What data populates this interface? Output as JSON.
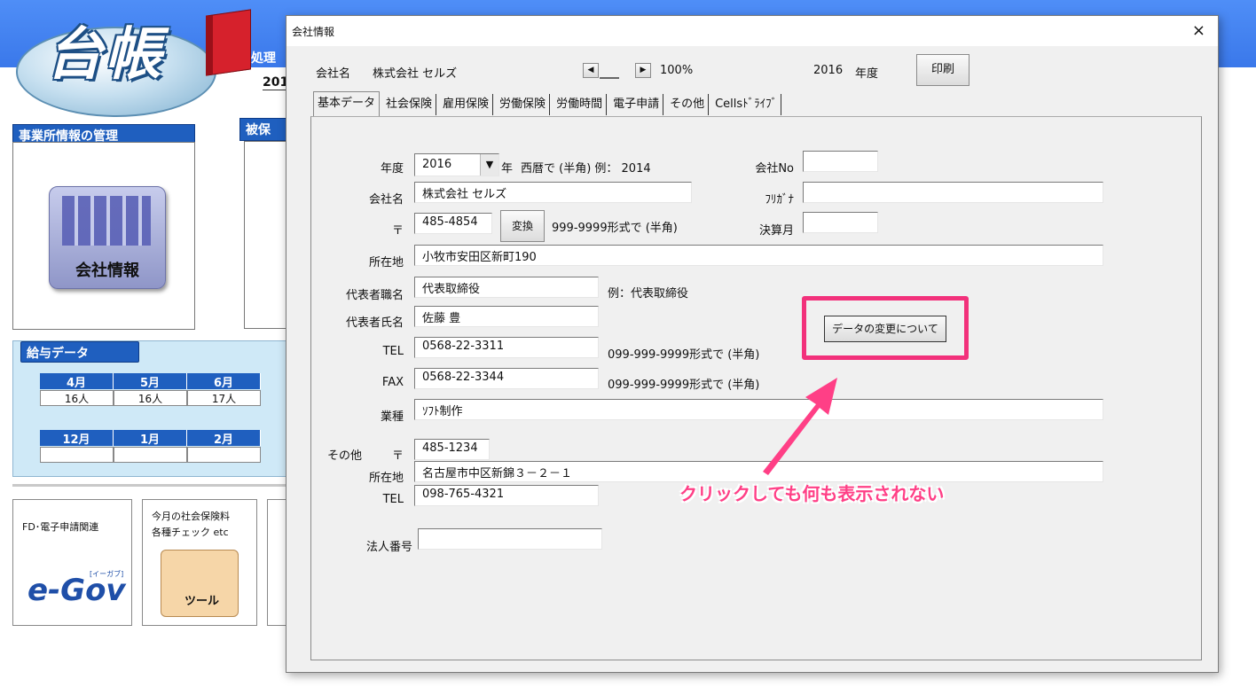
{
  "background_app": {
    "logo_text": "台帳",
    "proc_label": "処理",
    "year_partial": "201",
    "office_panel_header": "事業所情報の管理",
    "insured_panel_header": "被保",
    "company_icon_label": "会社情報",
    "salary_header": "給与データ",
    "months_row1": [
      "4月",
      "5月",
      "6月"
    ],
    "counts_row1": [
      "16人",
      "16人",
      "17人"
    ],
    "months_row2": [
      "12月",
      "1月",
      "2月"
    ],
    "tile1_label": "FD･電子申請関連",
    "tile1_logo": "e-Gov",
    "tile1_logo_sub": "[イーガブ]",
    "tile2_label_line1": "今月の社会保険料",
    "tile2_label_line2": "各種チェック etc",
    "tile2_icon_label": "ツール"
  },
  "dialog": {
    "title": "会社情報",
    "close_glyph": "×",
    "company_label": "会社名",
    "company_value": "株式会社 セルズ",
    "zoom_value": "100%",
    "year_value": "2016",
    "year_unit": "年度",
    "print_button": "印刷",
    "tabs": [
      "基本データ",
      "社会保険",
      "雇用保険",
      "労働保険",
      "労働時間",
      "電子申請",
      "その他",
      "Cellsﾄﾞﾗｲﾌﾞ"
    ],
    "form": {
      "year_label": "年度",
      "year": "2016",
      "year_suffix": "年",
      "year_hint": "西暦で (半角) 例： 2014",
      "company_no_label": "会社No",
      "company_no": "",
      "company_name_label": "会社名",
      "company_name": "株式会社 セルズ",
      "furigana_label": "ﾌﾘｶﾞﾅ",
      "furigana": "",
      "postal_label": "〒",
      "postal": "485-4854",
      "convert_button": "変換",
      "postal_hint": "999-9999形式で (半角)",
      "fiscal_month_label": "決算月",
      "fiscal_month": "",
      "address_label": "所在地",
      "address": "小牧市安田区新町190",
      "rep_title_label": "代表者職名",
      "rep_title": "代表取締役",
      "rep_title_hint": "例：代表取締役",
      "rep_name_label": "代表者氏名",
      "rep_name": "佐藤 豊",
      "data_change_button": "データの変更について",
      "tel_label": "TEL",
      "tel": "0568-22-3311",
      "tel_hint": "099-999-9999形式で (半角)",
      "fax_label": "FAX",
      "fax": "0568-22-3344",
      "fax_hint": "099-999-9999形式で (半角)",
      "industry_label": "業種",
      "industry": "ｿﾌﾄ制作",
      "other_label": "その他",
      "other_postal_label": "〒",
      "other_postal": "485-1234",
      "other_address_label": "所在地",
      "other_address": "名古屋市中区新錦３－２－１",
      "other_tel_label": "TEL",
      "other_tel": "098-765-4321",
      "corp_number_label": "法人番号",
      "corp_number": ""
    }
  },
  "annotation": {
    "callout_text": "クリックしても何も表示されない",
    "highlight_color": "#f2317b",
    "text_color": "#ff3f86"
  },
  "colors": {
    "topbar": "#3a78ea",
    "panel_header": "#1f5fbf"
  }
}
